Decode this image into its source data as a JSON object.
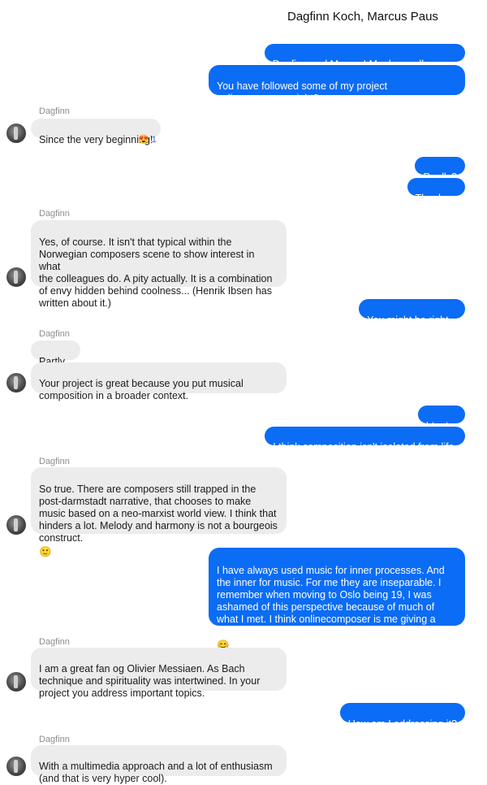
{
  "header": {
    "title": "Dagfinn Koch, Marcus Paus"
  },
  "messages": [
    {
      "id": "m1",
      "dir": "out",
      "text": "Dagfinn and Marcus! My dear colleagues",
      "emoji": "😊"
    },
    {
      "id": "m2",
      "dir": "out",
      "text": "You have followed some of my project\nonlinecomposer, right?"
    },
    {
      "id": "s1",
      "sender": "Dagfinn"
    },
    {
      "id": "m3",
      "dir": "in",
      "text": "Since the very beginning!",
      "reaction": {
        "emoji": "😍",
        "count": "1"
      }
    },
    {
      "id": "m4",
      "dir": "out",
      "text": "Really?",
      "emoji": "❤"
    },
    {
      "id": "m5",
      "dir": "out",
      "text": "Thanks..."
    },
    {
      "id": "s2",
      "sender": "Dagfinn"
    },
    {
      "id": "m6",
      "dir": "in",
      "text": "Yes, of course. It isn't that typical within the\nNorwegian composers scene to show interest in what\nthe colleagues do. A pity actually. It is a combination\nof envy hidden behind coolness... (Henrik Ibsen has\nwritten about it.)"
    },
    {
      "id": "m7",
      "dir": "out",
      "text": "You might be right..."
    },
    {
      "id": "s3",
      "sender": "Dagfinn"
    },
    {
      "id": "m8",
      "dir": "in",
      "text": "Partly..."
    },
    {
      "id": "m9",
      "dir": "in",
      "text": "Your project is great because you put musical\ncomposition in a broader context."
    },
    {
      "id": "m10",
      "dir": "out",
      "text": "I try to."
    },
    {
      "id": "m11",
      "dir": "out",
      "text": "I think composition isn't isolated from life."
    },
    {
      "id": "s4",
      "sender": "Dagfinn"
    },
    {
      "id": "m12",
      "dir": "in",
      "text": "So true. There are composers still trapped in the\npost-darmstadt narrative, that chooses to make\nmusic based on a neo-marxist world view. I think that\nhinders a lot. Melody and harmony is not a bourgeois\nconstruct.",
      "emoji": "🙂"
    },
    {
      "id": "m13",
      "dir": "out",
      "text": "I have always used music for inner processes. And\nthe inner for music. For me they are inseparable. I\nremember when moving to Oslo being 19, I was\nashamed of this perspective because of much of\nwhat I met. I think onlinecomposer is me giving a\ndamn shit about it. Having fun",
      "emoji": "😊"
    },
    {
      "id": "s5",
      "sender": "Dagfinn"
    },
    {
      "id": "m14",
      "dir": "in",
      "text": "I am a great fan og Olivier Messiaen. As Bach\ntechnique and spirituality was intertwined. In your\nproject you address important topics."
    },
    {
      "id": "m15",
      "dir": "out",
      "text": "How am I addressing it?"
    },
    {
      "id": "s6",
      "sender": "Dagfinn"
    },
    {
      "id": "m16",
      "dir": "in",
      "text": "With a multimedia approach and a lot of enthusiasm\n(and that is  very hyper cool)."
    }
  ]
}
